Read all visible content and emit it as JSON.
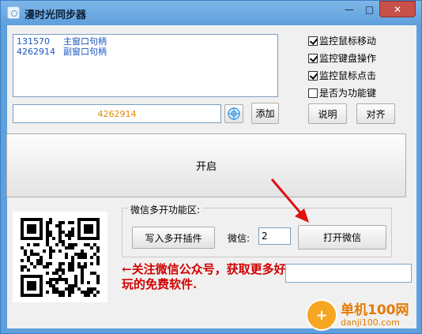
{
  "window": {
    "title": "漫时光同步器"
  },
  "handles": [
    {
      "id": "131570",
      "label": "主窗口句柄"
    },
    {
      "id": "4262914",
      "label": "副窗口句柄"
    }
  ],
  "checkboxes": [
    {
      "label": "监控鼠标移动",
      "checked": true
    },
    {
      "label": "监控键盘操作",
      "checked": true
    },
    {
      "label": "监控鼠标点击",
      "checked": true
    },
    {
      "label": "是否为功能键",
      "checked": false
    }
  ],
  "handle_input": {
    "value": "4262914"
  },
  "buttons": {
    "add": "添加",
    "help": "说明",
    "align": "对齐",
    "start": "开启",
    "write_plugin": "写入多开插件",
    "open_wechat": "打开微信"
  },
  "wechat_group": {
    "title": "微信多开功能区:",
    "count_label": "微信:",
    "count_value": "2"
  },
  "promo": {
    "text": "←关注微信公众号，获取更多好玩的免费软件."
  },
  "watermark": {
    "name": "单机100网",
    "url": "danji100.com"
  },
  "colors": {
    "titlebar": "#5f9fdc",
    "handle_text": "#1a55c0",
    "input_text": "#e08a00",
    "promo_text": "#d10000",
    "arrow": "#e01010"
  },
  "icons": {
    "window_controls": [
      "minimize-icon",
      "maximize-icon",
      "close-icon"
    ],
    "target": "crosshair-target-icon"
  }
}
